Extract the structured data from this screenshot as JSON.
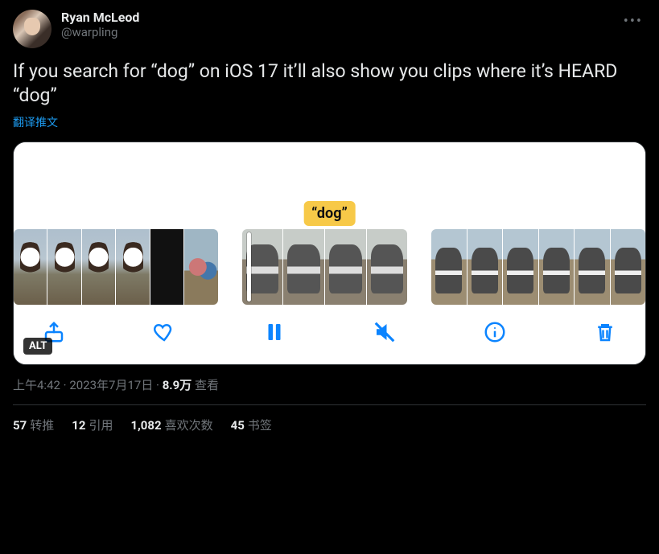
{
  "user": {
    "display_name": "Ryan McLeod",
    "handle": "@warpling"
  },
  "tweet": {
    "text": "If you search for “dog” on iOS 17 it’ll also show you clips where it’s HEARD “dog”",
    "translate_label": "翻译推文"
  },
  "media": {
    "search_chip": "“dog”",
    "alt_badge": "ALT",
    "toolbar": {
      "share": "share-icon",
      "like": "heart-icon",
      "pause": "pause-icon",
      "mute": "mute-icon",
      "info": "info-icon",
      "trash": "trash-icon"
    }
  },
  "meta": {
    "time": "上午4:42",
    "sep1": " · ",
    "date": "2023年7月17日",
    "sep2": " · ",
    "views_count": "8.9万",
    "views_label": " 查看"
  },
  "stats": {
    "retweets_count": "57",
    "retweets_label": "转推",
    "quotes_count": "12",
    "quotes_label": "引用",
    "likes_count": "1,082",
    "likes_label": "喜欢次数",
    "bookmarks_count": "45",
    "bookmarks_label": "书签"
  }
}
